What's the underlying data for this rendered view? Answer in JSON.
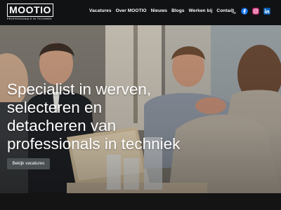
{
  "header": {
    "logo_text": "MOOTIO",
    "logo_tagline": "PROFESSIONALS IN TECHNIEK",
    "nav": [
      "Vacatures",
      "Over MOOTIO",
      "Nieuws",
      "Blogs",
      "Werken bij",
      "Contact"
    ],
    "social_icons": [
      "phone-icon",
      "facebook-icon",
      "instagram-icon",
      "linkedin-icon"
    ]
  },
  "hero": {
    "headline_lines": [
      "Specialist in werven,",
      "selecteren en",
      "detacheren van",
      "professionals in techniek"
    ],
    "cta_label": "Bekijk vacatures"
  },
  "colors": {
    "header_bg": "#111214",
    "cta_bg": "#4a5052",
    "text": "#ffffff"
  }
}
